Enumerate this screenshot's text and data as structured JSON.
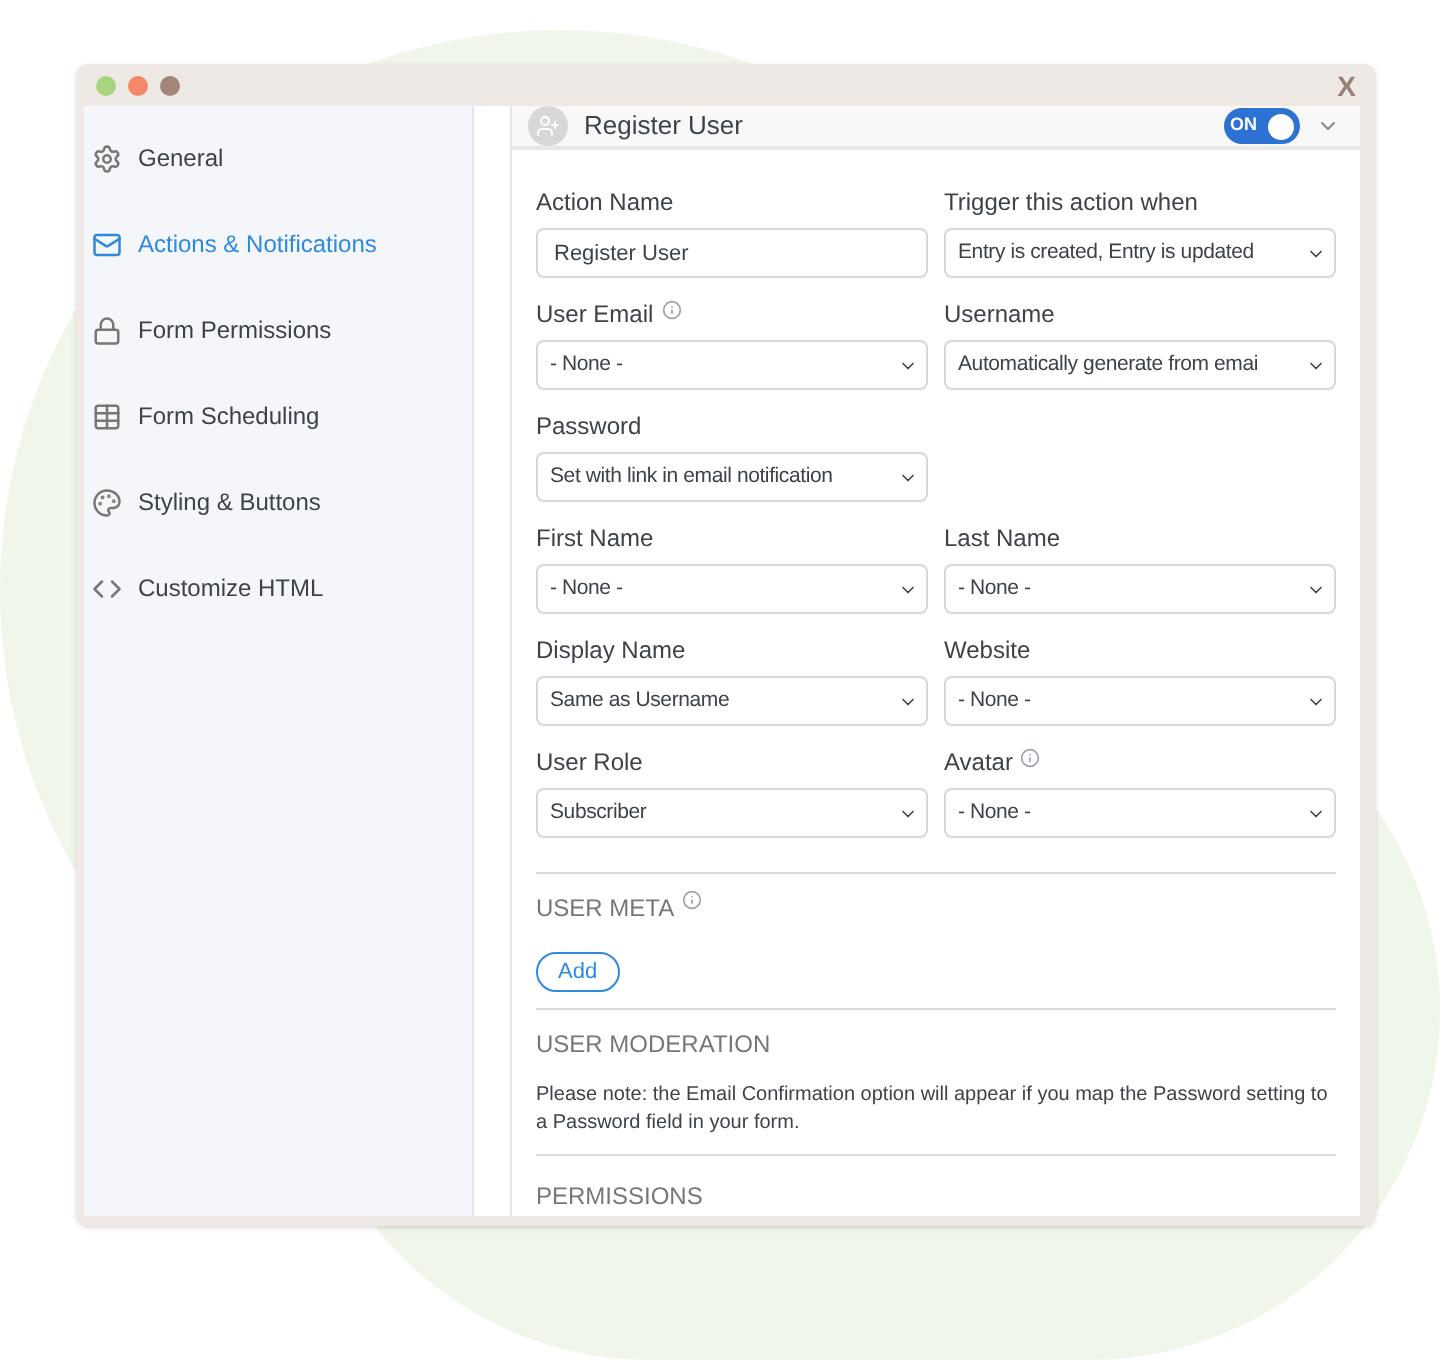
{
  "window": {
    "close": "X"
  },
  "sidebar": {
    "items": [
      {
        "label": "General",
        "selected": false
      },
      {
        "label": "Actions & Notifications",
        "selected": true
      },
      {
        "label": "Form Permissions",
        "selected": false
      },
      {
        "label": "Form Scheduling",
        "selected": false
      },
      {
        "label": "Styling & Buttons",
        "selected": false
      },
      {
        "label": "Customize HTML",
        "selected": false
      }
    ]
  },
  "action": {
    "title": "Register User",
    "toggle": {
      "label": "ON",
      "on": true
    },
    "expanded": true
  },
  "fields": [
    {
      "label": "Action Name",
      "kind": "input",
      "value": "Register User",
      "info": false
    },
    {
      "label": "Trigger this action when",
      "kind": "select",
      "value": "Entry is created, Entry is updated",
      "info": false
    },
    {
      "label": "User Email",
      "kind": "select",
      "value": "- None -",
      "info": true
    },
    {
      "label": "Username",
      "kind": "select",
      "value": "Automatically generate from emai",
      "info": false
    },
    {
      "label": "Password",
      "kind": "select",
      "value": "Set with link in email notification",
      "info": false
    },
    {
      "kind": "empty"
    },
    {
      "label": "First Name",
      "kind": "select",
      "value": "- None -",
      "info": false
    },
    {
      "label": "Last Name",
      "kind": "select",
      "value": "- None -",
      "info": false
    },
    {
      "label": "Display Name",
      "kind": "select",
      "value": "Same as Username",
      "info": false
    },
    {
      "label": "Website",
      "kind": "select",
      "value": "- None -",
      "info": false
    },
    {
      "label": "User Role",
      "kind": "select",
      "value": "Subscriber",
      "info": false
    },
    {
      "label": "Avatar",
      "kind": "select",
      "value": "- None -",
      "info": true
    }
  ],
  "user_meta": {
    "heading": "USER META",
    "info": true,
    "button": "Add"
  },
  "user_moderation": {
    "heading": "USER MODERATION",
    "note": "Please note: the Email Confirmation option will appear if you map the Password setting to a Password field in your form."
  },
  "permissions": {
    "heading": "PERMISSIONS"
  }
}
